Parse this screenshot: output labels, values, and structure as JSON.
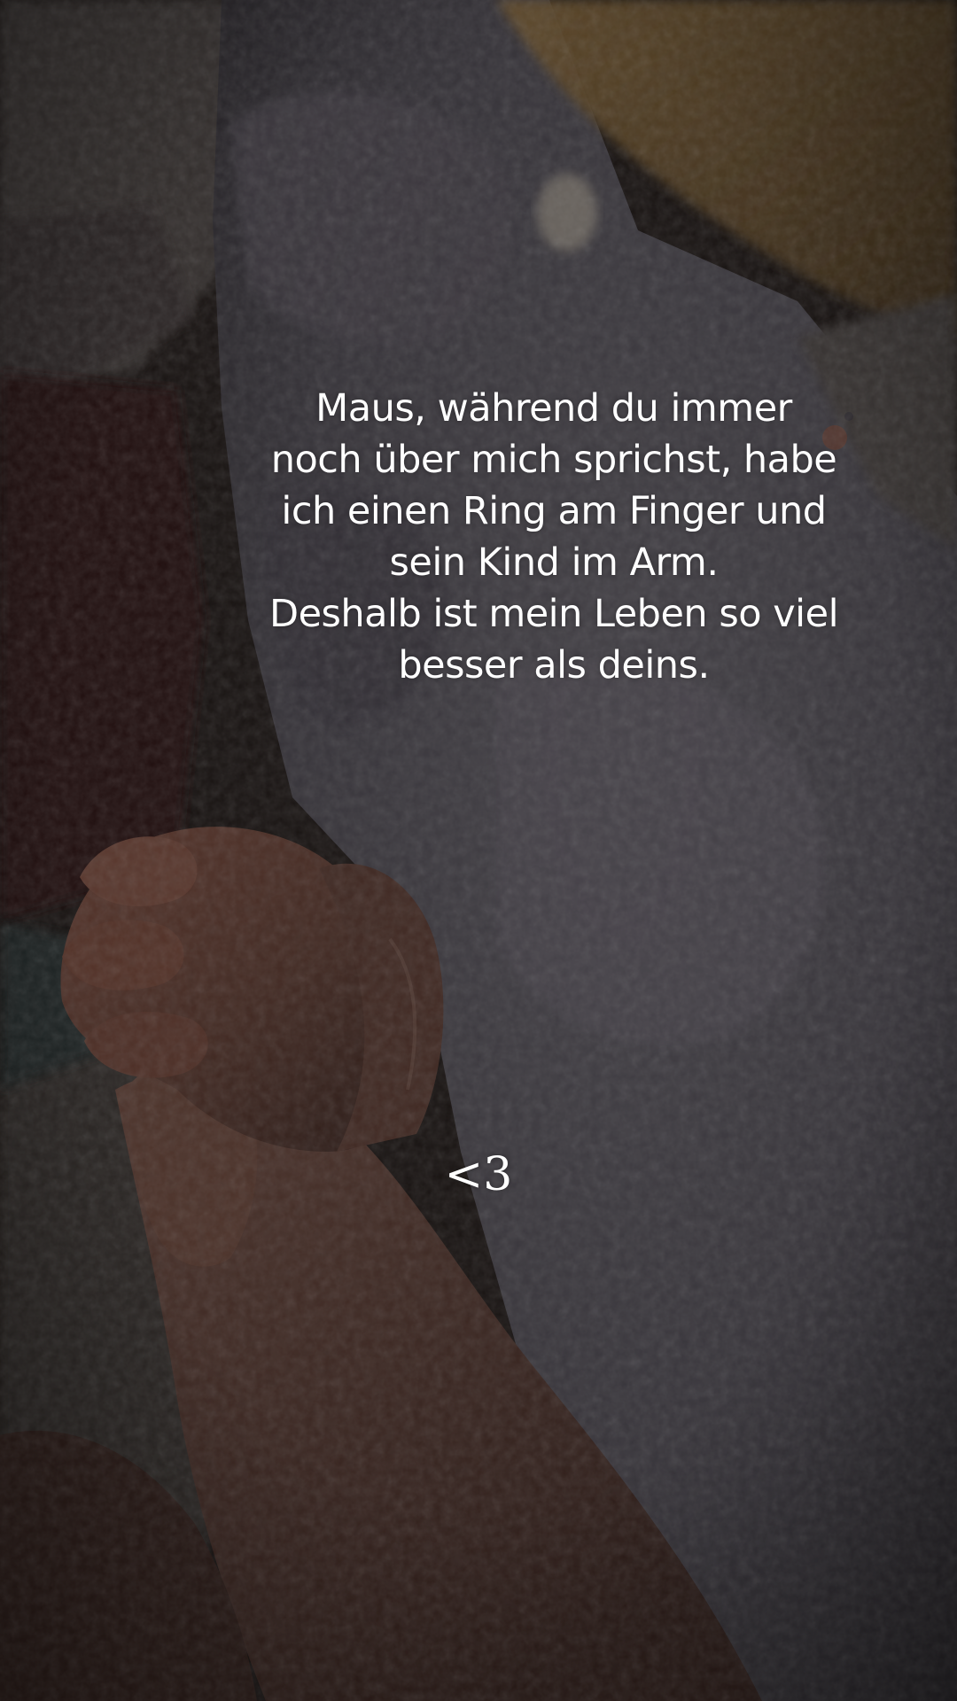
{
  "scene": {
    "photo_subject": "baby hand holding adult finger on a grey fuzzy blanket",
    "colors": {
      "blanket": "#5f5b63",
      "skin": "#6b4538",
      "background": "#1e1917",
      "text": "#ffffff"
    }
  },
  "caption": {
    "lines": [
      "Maus, während du immer",
      "noch über mich sprichst, habe",
      "ich einen Ring am Finger und",
      "sein Kind im Arm.",
      "Deshalb ist mein Leben so viel",
      "besser als deins."
    ]
  },
  "sticker": {
    "text": "<3"
  }
}
